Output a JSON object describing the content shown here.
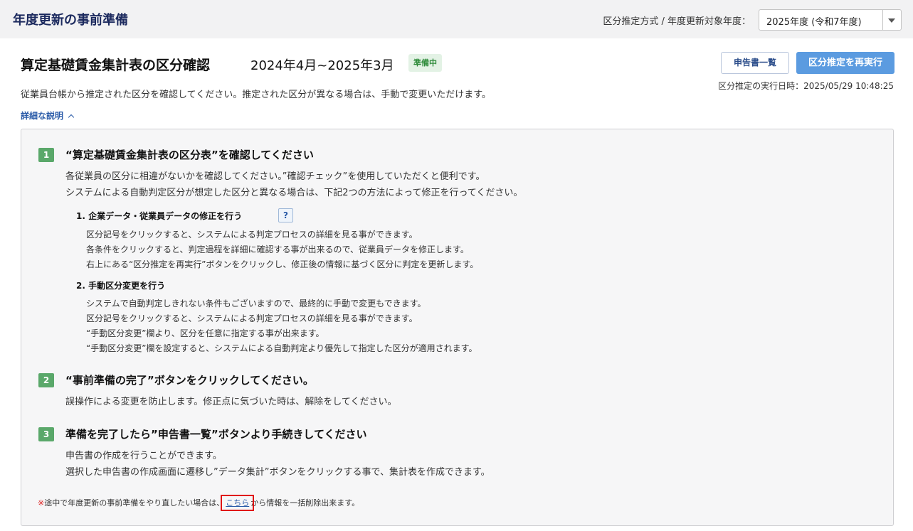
{
  "header": {
    "title": "年度更新の事前準備",
    "year_label": "区分推定方式 / 年度更新対象年度：",
    "year_select_value": "2025年度 (令和7年度)"
  },
  "main": {
    "title": "算定基礎賃金集計表の区分確認",
    "period": "2024年4月~2025年3月",
    "status_badge": "準備中",
    "description": "従業員台帳から推定された区分を確認してください。推定された区分が異なる場合は、手動で変更いただけます。",
    "detail_toggle": "詳細な説明",
    "buttons": {
      "list_label": "申告書一覧",
      "rerun_label": "区分推定を再実行"
    },
    "exec_time": "区分推定の実行日時：2025/05/29 10:48:25"
  },
  "steps": [
    {
      "num": "1",
      "title": "“算定基礎賃金集計表の区分表”を確認してください",
      "lines": [
        "各従業員の区分に相違がないかを確認してください。”確認チェック”を使用していただくと便利です。",
        "システムによる自動判定区分が想定した区分と異なる場合は、下記2つの方法によって修正を行ってください。"
      ],
      "subs": [
        {
          "title": "1. 企業データ・従業員データの修正を行う",
          "help_icon": "?",
          "lines": [
            "区分記号をクリックすると、システムによる判定プロセスの詳細を見る事ができます。",
            "各条件をクリックすると、判定過程を詳細に確認する事が出来るので、従業員データを修正します。",
            "右上にある“区分推定を再実行”ボタンをクリックし、修正後の情報に基づく区分に判定を更新します。"
          ]
        },
        {
          "title": "2. 手動区分変更を行う",
          "lines": [
            "システムで自動判定しきれない条件もございますので、最終的に手動で変更もできます。",
            "区分記号をクリックすると、システムによる判定プロセスの詳細を見る事ができます。",
            "“手動区分変更”欄より、区分を任意に指定する事が出来ます。",
            "“手動区分変更”欄を設定すると、システムによる自動判定より優先して指定した区分が適用されます。"
          ]
        }
      ]
    },
    {
      "num": "2",
      "title": "“事前準備の完了”ボタンをクリックしてください。",
      "lines": [
        "誤操作による変更を防止します。修正点に気づいた時は、解除をしてください。"
      ]
    },
    {
      "num": "3",
      "title": "準備を完了したら”申告書一覧”ボタンより手続きしてください",
      "lines": [
        "申告書の作成を行うことができます。",
        "選択した申告書の作成画面に遷移し”データ集計”ボタンをクリックする事で、集計表を作成できます。"
      ]
    }
  ],
  "note": {
    "mark": "※",
    "prefix": "途中で年度更新の事前準備をやり直したい場合は、",
    "link": "こちら",
    "suffix": "から情報を一括削除出来ます。"
  }
}
